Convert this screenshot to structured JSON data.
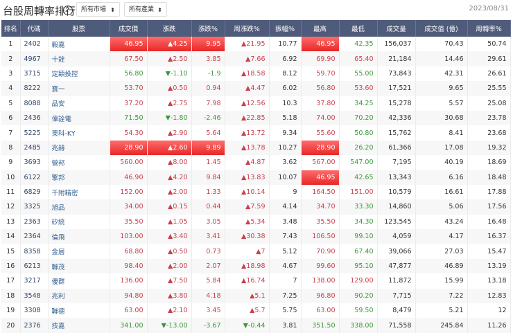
{
  "header": {
    "title": "台股周轉率排行",
    "help": "?",
    "market_filter": "所有市場",
    "industry_filter": "所有產業",
    "date": "2023/08/31"
  },
  "table": {
    "columns": [
      "排名",
      "代碼",
      "股票",
      "成交價",
      "漲跌",
      "漲跌%",
      "周漲跌%",
      "振幅%",
      "最高",
      "最低",
      "成交量",
      "成交值 (億)",
      "周轉率%"
    ],
    "rows": [
      [
        [
          "1"
        ],
        [
          "2402"
        ],
        [
          "毅嘉"
        ],
        [
          "46.95",
          "L"
        ],
        [
          "▲4.25",
          "L"
        ],
        [
          "9.95",
          "L"
        ],
        [
          "▲21.95",
          "u"
        ],
        [
          "10.77"
        ],
        [
          "46.95",
          "L"
        ],
        [
          "42.35",
          "d"
        ],
        [
          "156,037"
        ],
        [
          "70.43"
        ],
        [
          "50.74"
        ]
      ],
      [
        [
          "2"
        ],
        [
          "4967"
        ],
        [
          "十銓"
        ],
        [
          "67.50",
          "u"
        ],
        [
          "▲2.50",
          "u"
        ],
        [
          "3.85",
          "u"
        ],
        [
          "▲7.66",
          "u"
        ],
        [
          "6.92"
        ],
        [
          "69.90",
          "u"
        ],
        [
          "65.40",
          "u"
        ],
        [
          "21,184"
        ],
        [
          "14.46"
        ],
        [
          "29.61"
        ]
      ],
      [
        [
          "3"
        ],
        [
          "3715"
        ],
        [
          "定穎投控"
        ],
        [
          "56.80",
          "d"
        ],
        [
          "▼-1.10",
          "d"
        ],
        [
          "-1.9",
          "d"
        ],
        [
          "▲18.58",
          "u"
        ],
        [
          "8.12"
        ],
        [
          "59.70",
          "u"
        ],
        [
          "55.00",
          "d"
        ],
        [
          "73,843"
        ],
        [
          "42.31"
        ],
        [
          "26.61"
        ]
      ],
      [
        [
          "4"
        ],
        [
          "8222"
        ],
        [
          "寶一"
        ],
        [
          "53.70",
          "u"
        ],
        [
          "▲0.50",
          "u"
        ],
        [
          "0.94",
          "u"
        ],
        [
          "▲4.47",
          "u"
        ],
        [
          "6.02"
        ],
        [
          "56.80",
          "u"
        ],
        [
          "53.60",
          "u"
        ],
        [
          "17,521"
        ],
        [
          "9.65"
        ],
        [
          "25.55"
        ]
      ],
      [
        [
          "5"
        ],
        [
          "8088"
        ],
        [
          "品安"
        ],
        [
          "37.20",
          "u"
        ],
        [
          "▲2.75",
          "u"
        ],
        [
          "7.98",
          "u"
        ],
        [
          "▲12.56",
          "u"
        ],
        [
          "10.3"
        ],
        [
          "37.80",
          "u"
        ],
        [
          "34.25",
          "d"
        ],
        [
          "15,278"
        ],
        [
          "5.57"
        ],
        [
          "25.08"
        ]
      ],
      [
        [
          "6"
        ],
        [
          "2436"
        ],
        [
          "偉詮電"
        ],
        [
          "71.50",
          "d"
        ],
        [
          "▼-1.80",
          "d"
        ],
        [
          "-2.46",
          "d"
        ],
        [
          "▲22.85",
          "u"
        ],
        [
          "5.18"
        ],
        [
          "74.00",
          "u"
        ],
        [
          "70.20",
          "d"
        ],
        [
          "42,336"
        ],
        [
          "30.68"
        ],
        [
          "23.78"
        ]
      ],
      [
        [
          "7"
        ],
        [
          "5225"
        ],
        [
          "東科-KY"
        ],
        [
          "54.30",
          "u"
        ],
        [
          "▲2.90",
          "u"
        ],
        [
          "5.64",
          "u"
        ],
        [
          "▲13.72",
          "u"
        ],
        [
          "9.34"
        ],
        [
          "55.60",
          "u"
        ],
        [
          "50.80",
          "d"
        ],
        [
          "15,762"
        ],
        [
          "8.41"
        ],
        [
          "23.68"
        ]
      ],
      [
        [
          "8"
        ],
        [
          "2485"
        ],
        [
          "兆赫"
        ],
        [
          "28.90",
          "L"
        ],
        [
          "▲2.60",
          "L"
        ],
        [
          "9.89",
          "L"
        ],
        [
          "▲13.78",
          "u"
        ],
        [
          "10.27"
        ],
        [
          "28.90",
          "L"
        ],
        [
          "26.20",
          "d"
        ],
        [
          "61,366"
        ],
        [
          "17.08"
        ],
        [
          "19.32"
        ]
      ],
      [
        [
          "9"
        ],
        [
          "3693"
        ],
        [
          "營邦"
        ],
        [
          "560.00",
          "u"
        ],
        [
          "▲8.00",
          "u"
        ],
        [
          "1.45",
          "u"
        ],
        [
          "▲4.87",
          "u"
        ],
        [
          "3.62"
        ],
        [
          "567.00",
          "u"
        ],
        [
          "547.00",
          "d"
        ],
        [
          "7,195"
        ],
        [
          "40.19"
        ],
        [
          "18.69"
        ]
      ],
      [
        [
          "10"
        ],
        [
          "6122"
        ],
        [
          "擎邦"
        ],
        [
          "46.90",
          "u"
        ],
        [
          "▲4.20",
          "u"
        ],
        [
          "9.84",
          "u"
        ],
        [
          "▲13.83",
          "u"
        ],
        [
          "10.07"
        ],
        [
          "46.95",
          "L"
        ],
        [
          "42.65",
          "d"
        ],
        [
          "13,343"
        ],
        [
          "6.16"
        ],
        [
          "18.48"
        ]
      ],
      [
        [
          "11"
        ],
        [
          "6829"
        ],
        [
          "千附精密"
        ],
        [
          "152.00",
          "u"
        ],
        [
          "▲2.00",
          "u"
        ],
        [
          "1.33",
          "u"
        ],
        [
          "▲10.14",
          "u"
        ],
        [
          "9"
        ],
        [
          "164.50",
          "u"
        ],
        [
          "151.00",
          "u"
        ],
        [
          "10,579"
        ],
        [
          "16.61"
        ],
        [
          "17.88"
        ]
      ],
      [
        [
          "12"
        ],
        [
          "3325"
        ],
        [
          "旭品"
        ],
        [
          "34.00",
          "u"
        ],
        [
          "▲0.15",
          "u"
        ],
        [
          "0.44",
          "u"
        ],
        [
          "▲7.59",
          "u"
        ],
        [
          "4.14"
        ],
        [
          "34.70",
          "u"
        ],
        [
          "33.30",
          "d"
        ],
        [
          "14,860"
        ],
        [
          "5.06"
        ],
        [
          "17.56"
        ]
      ],
      [
        [
          "13"
        ],
        [
          "2363"
        ],
        [
          "矽統"
        ],
        [
          "35.50",
          "u"
        ],
        [
          "▲1.05",
          "u"
        ],
        [
          "3.05",
          "u"
        ],
        [
          "▲5.34",
          "u"
        ],
        [
          "3.48"
        ],
        [
          "35.50",
          "u"
        ],
        [
          "34.30",
          "d"
        ],
        [
          "123,545"
        ],
        [
          "43.24"
        ],
        [
          "16.48"
        ]
      ],
      [
        [
          "14"
        ],
        [
          "2364"
        ],
        [
          "倫飛"
        ],
        [
          "103.00",
          "u"
        ],
        [
          "▲3.40",
          "u"
        ],
        [
          "3.41",
          "u"
        ],
        [
          "▲30.38",
          "u"
        ],
        [
          "7.43"
        ],
        [
          "106.50",
          "u"
        ],
        [
          "99.10",
          "d"
        ],
        [
          "4,059"
        ],
        [
          "4.17"
        ],
        [
          "16.37"
        ]
      ],
      [
        [
          "15"
        ],
        [
          "8358"
        ],
        [
          "金居"
        ],
        [
          "68.80",
          "u"
        ],
        [
          "▲0.50",
          "u"
        ],
        [
          "0.73",
          "u"
        ],
        [
          "▲7",
          "u"
        ],
        [
          "5.12"
        ],
        [
          "70.90",
          "u"
        ],
        [
          "67.40",
          "d"
        ],
        [
          "39,066"
        ],
        [
          "27.03"
        ],
        [
          "15.47"
        ]
      ],
      [
        [
          "16"
        ],
        [
          "6213"
        ],
        [
          "聯茂"
        ],
        [
          "98.40",
          "u"
        ],
        [
          "▲2.00",
          "u"
        ],
        [
          "2.07",
          "u"
        ],
        [
          "▲18.98",
          "u"
        ],
        [
          "4.67"
        ],
        [
          "99.60",
          "u"
        ],
        [
          "95.10",
          "d"
        ],
        [
          "47,877"
        ],
        [
          "46.89"
        ],
        [
          "13.19"
        ]
      ],
      [
        [
          "17"
        ],
        [
          "3217"
        ],
        [
          "優群"
        ],
        [
          "136.00",
          "u"
        ],
        [
          "▲7.50",
          "u"
        ],
        [
          "5.84",
          "u"
        ],
        [
          "▲16.74",
          "u"
        ],
        [
          "7"
        ],
        [
          "138.00",
          "u"
        ],
        [
          "129.00",
          "u"
        ],
        [
          "11,872"
        ],
        [
          "15.99"
        ],
        [
          "13.18"
        ]
      ],
      [
        [
          "18"
        ],
        [
          "3548"
        ],
        [
          "兆利"
        ],
        [
          "94.80",
          "u"
        ],
        [
          "▲3.80",
          "u"
        ],
        [
          "4.18",
          "u"
        ],
        [
          "▲5.1",
          "u"
        ],
        [
          "7.25"
        ],
        [
          "96.80",
          "u"
        ],
        [
          "90.20",
          "d"
        ],
        [
          "7,715"
        ],
        [
          "7.22"
        ],
        [
          "12.83"
        ]
      ],
      [
        [
          "19"
        ],
        [
          "3308"
        ],
        [
          "聯德"
        ],
        [
          "63.00",
          "u"
        ],
        [
          "▲2.10",
          "u"
        ],
        [
          "3.45",
          "u"
        ],
        [
          "▲5.7",
          "u"
        ],
        [
          "5.75"
        ],
        [
          "63.00",
          "u"
        ],
        [
          "59.50",
          "d"
        ],
        [
          "8,479"
        ],
        [
          "5.21"
        ],
        [
          "12"
        ]
      ],
      [
        [
          "20"
        ],
        [
          "2376"
        ],
        [
          "技嘉"
        ],
        [
          "341.00",
          "d"
        ],
        [
          "▼-13.00",
          "d"
        ],
        [
          "-3.67",
          "d"
        ],
        [
          "▼-0.44",
          "d"
        ],
        [
          "3.81"
        ],
        [
          "351.50",
          "d"
        ],
        [
          "338.00",
          "d"
        ],
        [
          "71,558"
        ],
        [
          "245.84"
        ],
        [
          "11.26"
        ]
      ]
    ]
  }
}
